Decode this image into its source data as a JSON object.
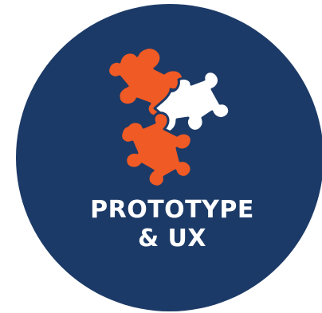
{
  "badge": {
    "title_line_1": "PROTOTYPE",
    "title_line_2": "& UX",
    "icon": "puzzle-pieces-icon",
    "colors": {
      "background": "#1c3a67",
      "accent": "#f05a24",
      "piece_light": "#ffffff",
      "text": "#ffffff"
    }
  }
}
